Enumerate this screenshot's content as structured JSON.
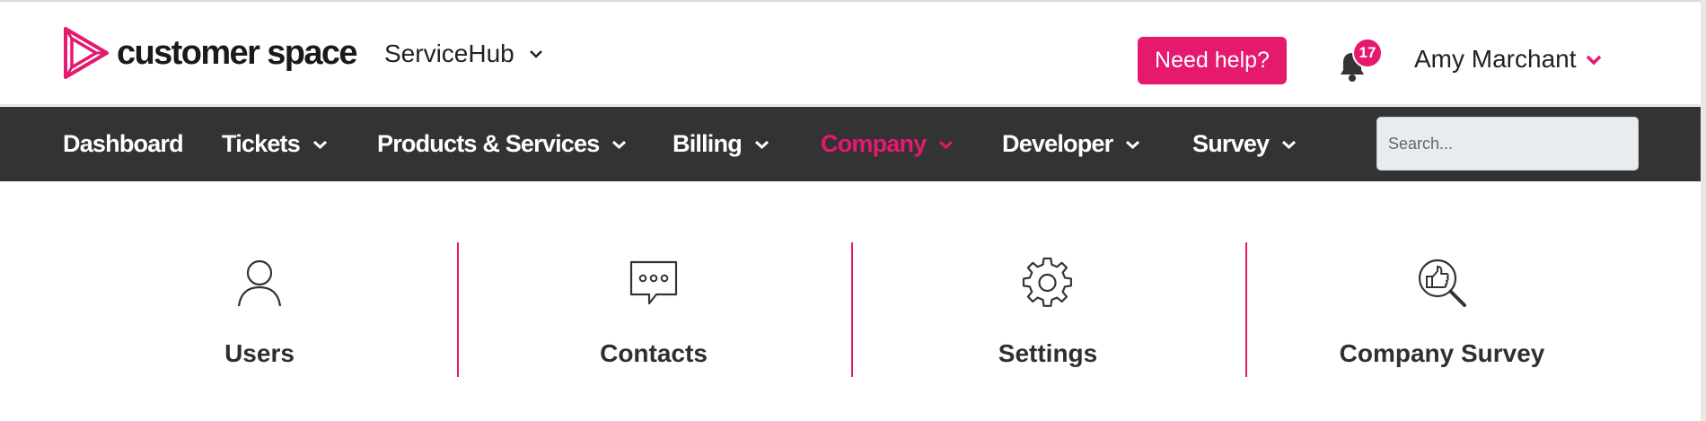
{
  "header": {
    "logo_text": "customer space",
    "hub_label": "ServiceHub",
    "help_label": "Need help?",
    "notification_count": "17",
    "user_name": "Amy Marchant"
  },
  "nav": {
    "items": [
      {
        "label": "Dashboard",
        "dropdown": false,
        "active": false
      },
      {
        "label": "Tickets",
        "dropdown": true,
        "active": false
      },
      {
        "label": "Products & Services",
        "dropdown": true,
        "active": false
      },
      {
        "label": "Billing",
        "dropdown": true,
        "active": false
      },
      {
        "label": "Company",
        "dropdown": true,
        "active": true
      },
      {
        "label": "Developer",
        "dropdown": true,
        "active": false
      },
      {
        "label": "Survey",
        "dropdown": true,
        "active": false
      }
    ],
    "search_placeholder": "Search..."
  },
  "tiles": [
    {
      "label": "Users",
      "icon": "user-icon"
    },
    {
      "label": "Contacts",
      "icon": "chat-bubble-icon"
    },
    {
      "label": "Settings",
      "icon": "gear-icon"
    },
    {
      "label": "Company Survey",
      "icon": "survey-magnifier-icon"
    }
  ],
  "colors": {
    "accent": "#e5196e",
    "nav_background": "#333333",
    "nav_text": "#ffffff"
  }
}
